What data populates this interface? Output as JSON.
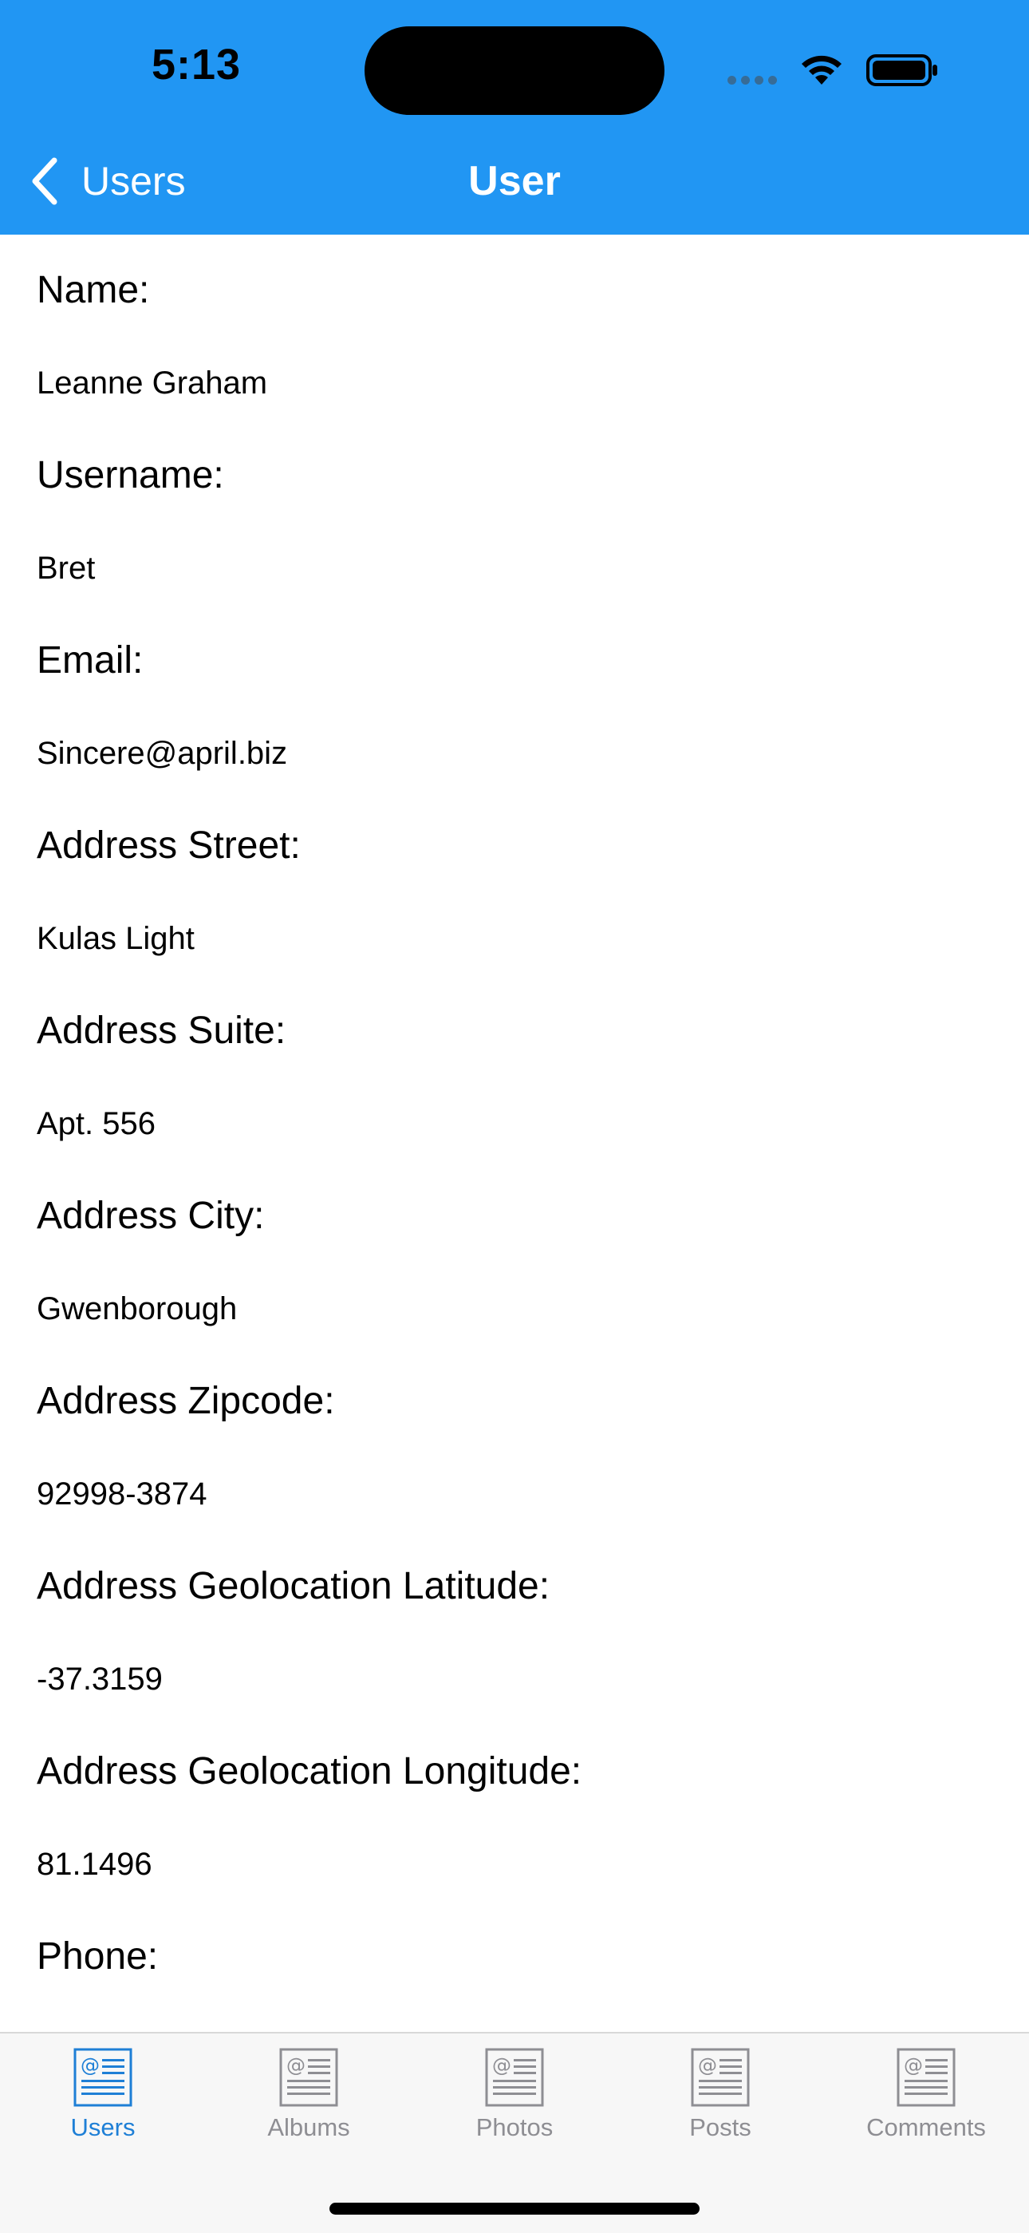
{
  "status_bar": {
    "time": "5:13"
  },
  "nav": {
    "back_label": "Users",
    "title": "User"
  },
  "fields": [
    {
      "label": "Name:",
      "value": "Leanne Graham"
    },
    {
      "label": "Username:",
      "value": "Bret"
    },
    {
      "label": "Email:",
      "value": "Sincere@april.biz"
    },
    {
      "label": "Address Street:",
      "value": "Kulas Light"
    },
    {
      "label": "Address Suite:",
      "value": "Apt. 556"
    },
    {
      "label": "Address City:",
      "value": "Gwenborough"
    },
    {
      "label": "Address Zipcode:",
      "value": "92998-3874"
    },
    {
      "label": "Address Geolocation Latitude:",
      "value": "-37.3159"
    },
    {
      "label": "Address Geolocation Longitude:",
      "value": "81.1496"
    },
    {
      "label": "Phone:",
      "value": ""
    }
  ],
  "tabs": [
    {
      "label": "Users",
      "icon": "news-icon",
      "active": true
    },
    {
      "label": "Albums",
      "icon": "news-icon",
      "active": false
    },
    {
      "label": "Photos",
      "icon": "news-icon",
      "active": false
    },
    {
      "label": "Posts",
      "icon": "news-icon",
      "active": false
    },
    {
      "label": "Comments",
      "icon": "news-icon",
      "active": false
    }
  ],
  "colors": {
    "header": "#2196F3",
    "tab_active": "#1e7fd6",
    "tab_inactive": "#8e8e93"
  }
}
